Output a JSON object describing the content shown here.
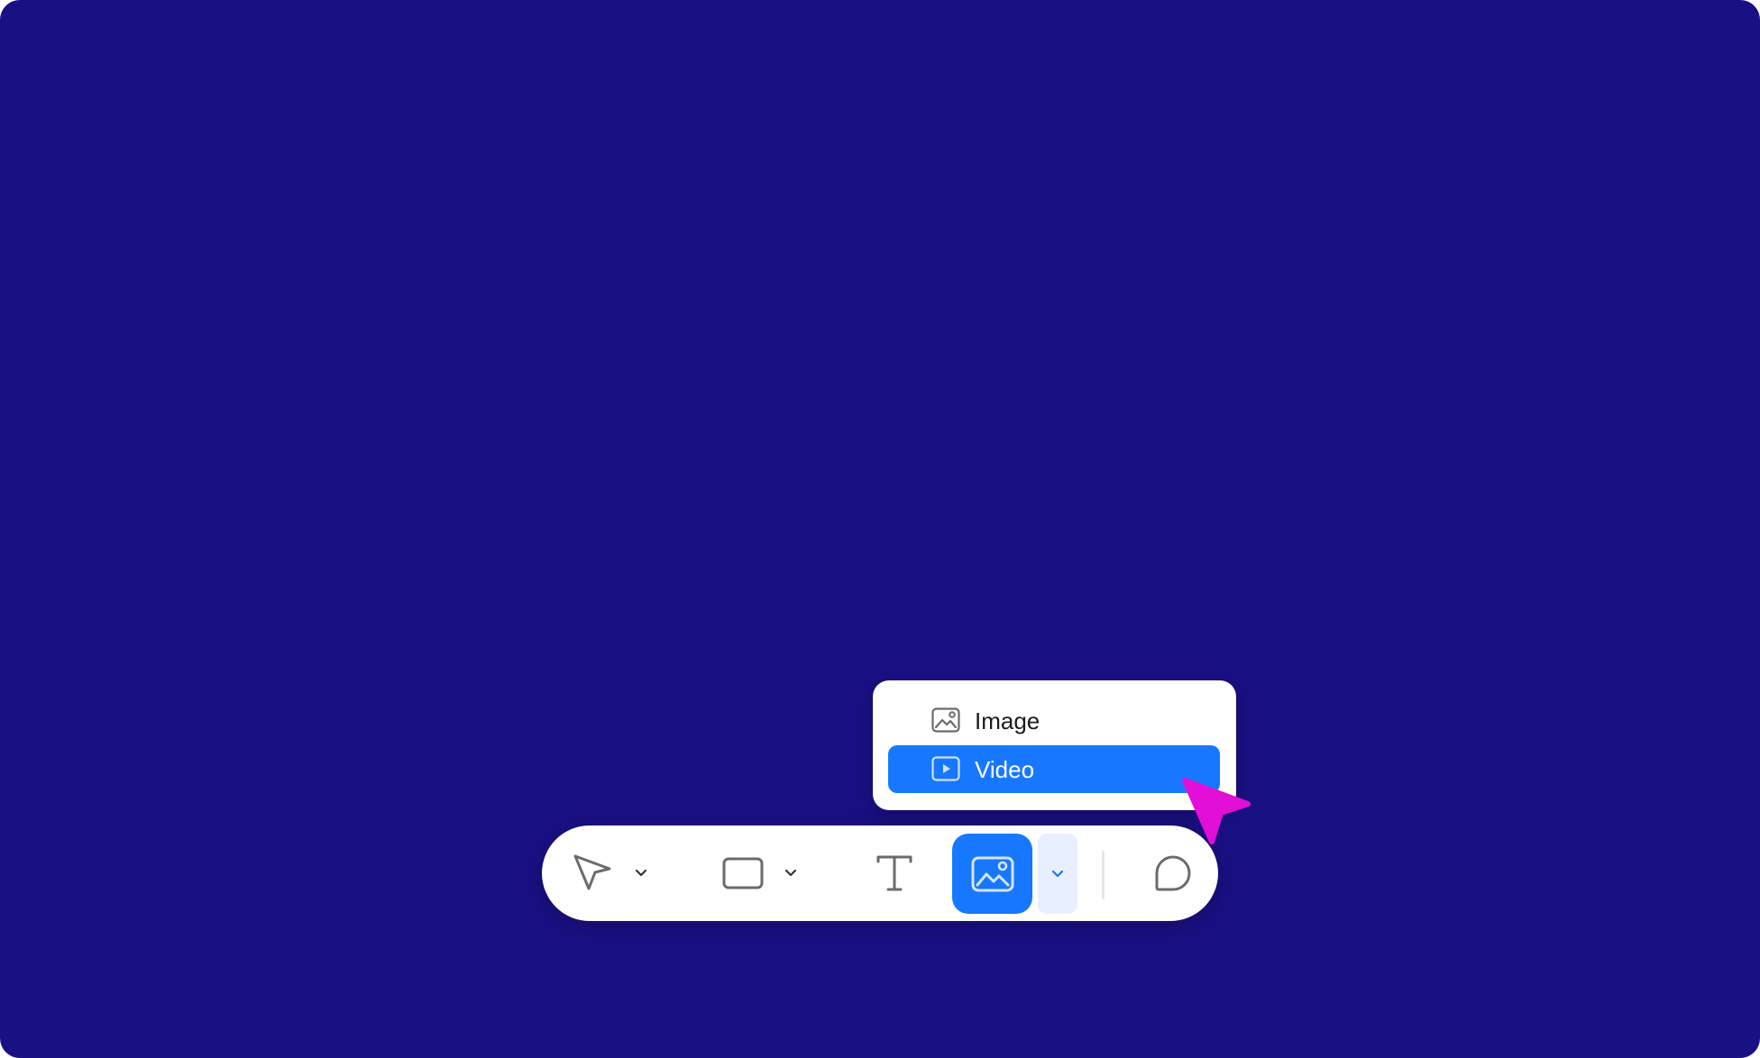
{
  "menu": {
    "items": [
      {
        "label": "Image",
        "icon": "image-icon",
        "selected": false
      },
      {
        "label": "Video",
        "icon": "video-icon",
        "selected": true
      }
    ]
  },
  "toolbar": {
    "tools": [
      {
        "name": "move",
        "icon": "pointer-arrow-icon",
        "has_dropdown": true
      },
      {
        "name": "shape",
        "icon": "rectangle-icon",
        "has_dropdown": true
      },
      {
        "name": "text",
        "icon": "text-t-icon",
        "has_dropdown": false
      },
      {
        "name": "media",
        "icon": "image-icon",
        "has_dropdown": true,
        "active": true
      },
      {
        "name": "comment",
        "icon": "comment-bubble-icon",
        "has_dropdown": false
      }
    ]
  },
  "colors": {
    "background": "#1a1085",
    "accent": "#1778ff",
    "accent_light": "#e8efff",
    "cursor": "#e20fd6",
    "surface": "#ffffff"
  }
}
